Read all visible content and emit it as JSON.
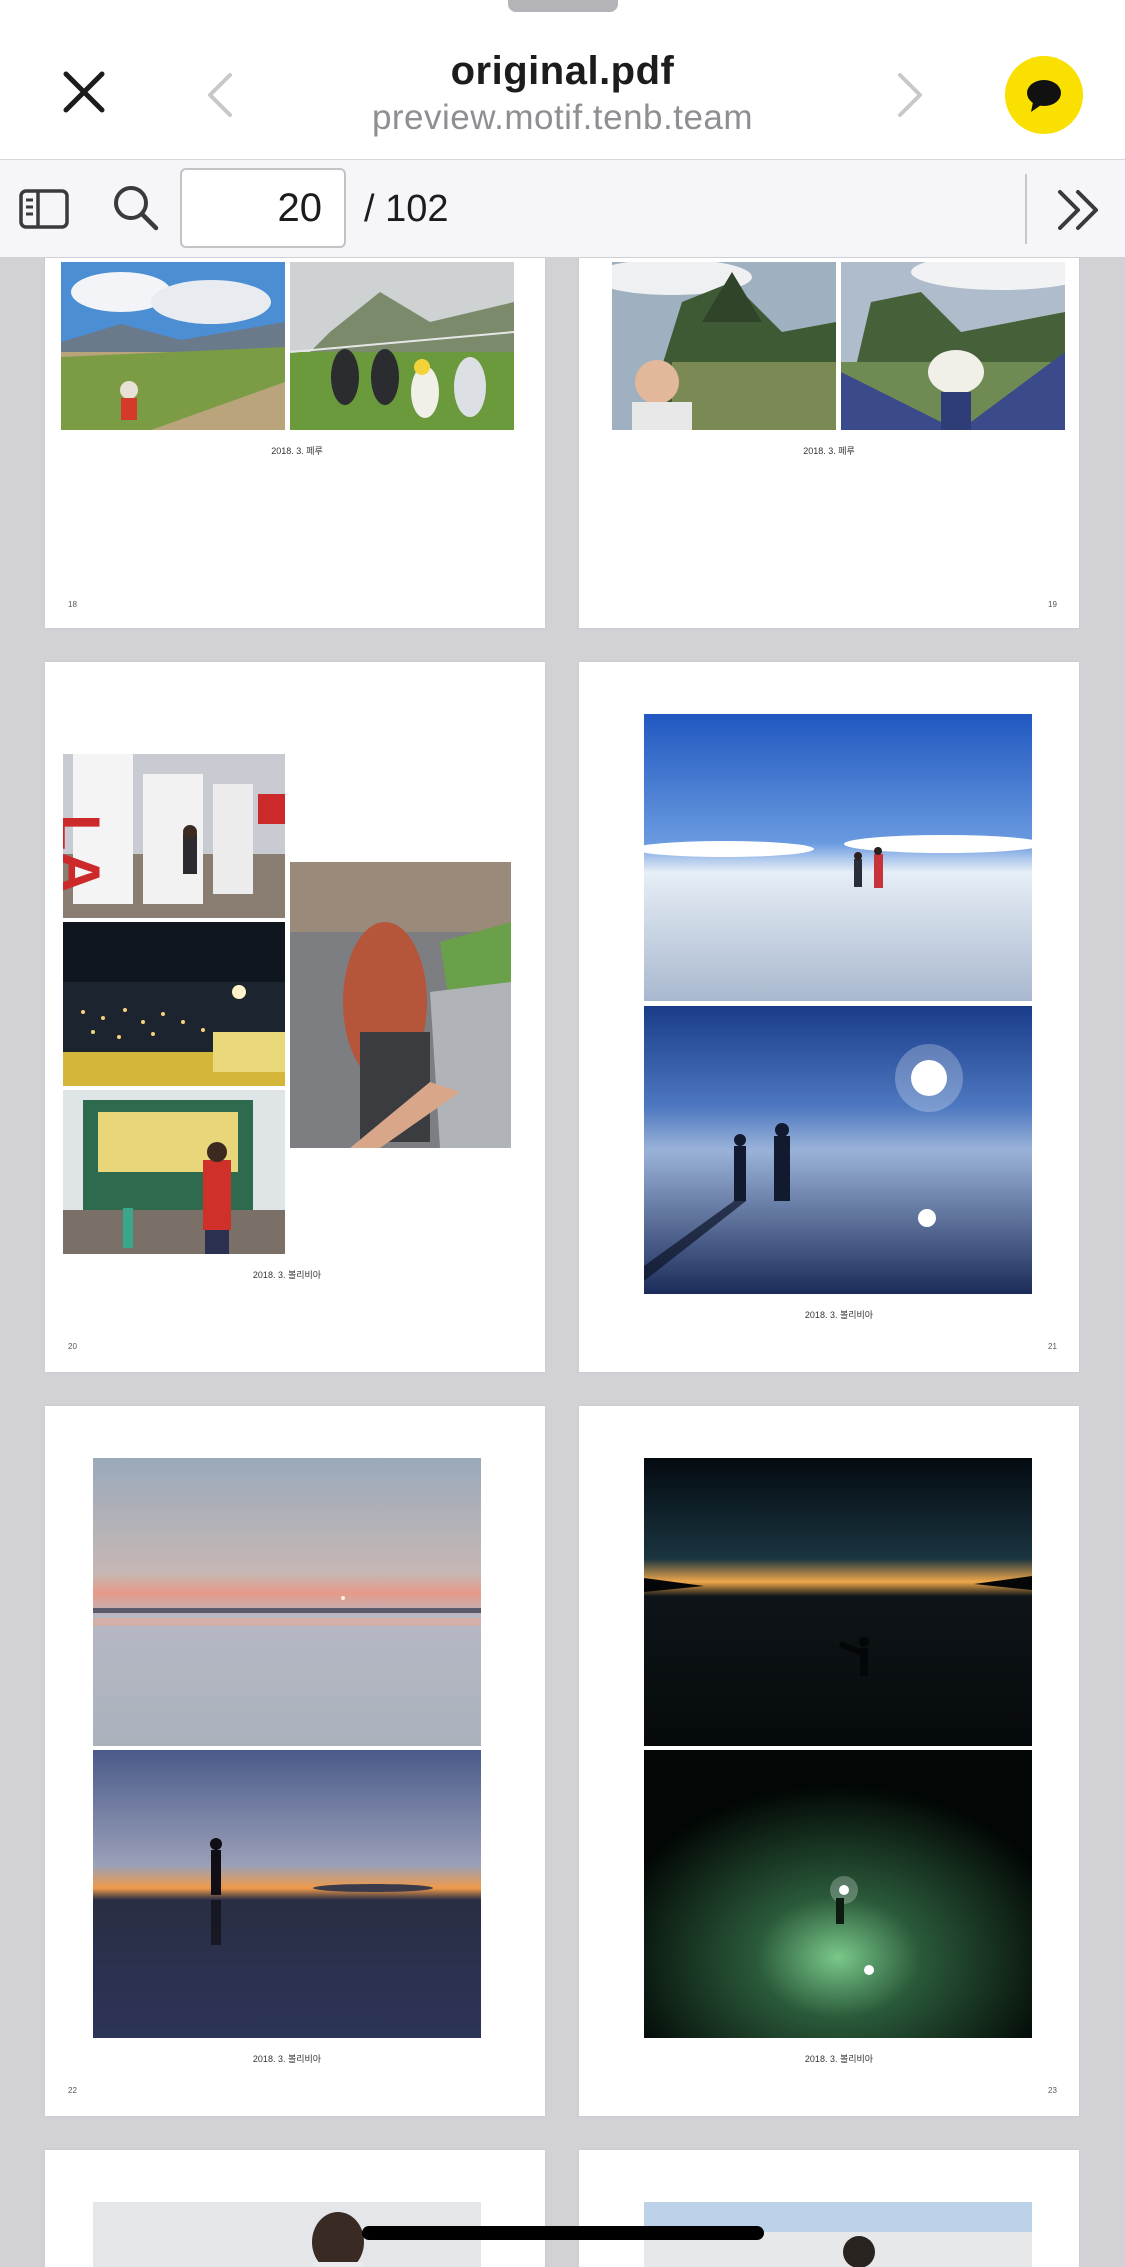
{
  "header": {
    "title": "original.pdf",
    "host": "preview.motif.tenb.team",
    "icons": {
      "close": "close-icon",
      "back": "chevron-left-icon",
      "forward": "chevron-right-icon",
      "chat": "chat-bubble-icon"
    },
    "chat_color": "#f9e000"
  },
  "toolbar": {
    "page_value": "20",
    "page_total": "/ 102",
    "icons": {
      "sidebar": "sidebar-icon",
      "search": "search-icon",
      "expand": "double-chevron-right-icon"
    }
  },
  "pages": [
    {
      "number": "18",
      "caption": "2018. 3. 페루",
      "photos": [
        "grassy-hill-child",
        "feet-at-machu-picchu"
      ]
    },
    {
      "number": "19",
      "caption": "2018. 3. 페루",
      "photos": [
        "machu-picchu-man",
        "machu-picchu-arms-raised"
      ]
    },
    {
      "number": "20",
      "caption": "2018. 3. 볼리비아",
      "photos": [
        "city-sign",
        "night-city",
        "food-stall",
        "follow-me-hand"
      ]
    },
    {
      "number": "21",
      "caption": "2018. 3. 볼리비아",
      "photos": [
        "salt-flat-couple-day",
        "salt-flat-couple-sun"
      ]
    },
    {
      "number": "22",
      "caption": "2018. 3. 볼리비아",
      "photos": [
        "salt-flat-dusk",
        "salt-flat-silhouette"
      ]
    },
    {
      "number": "23",
      "caption": "2018. 3. 볼리비아",
      "photos": [
        "salt-flat-sunset-kick",
        "salt-flat-night-light"
      ]
    }
  ]
}
